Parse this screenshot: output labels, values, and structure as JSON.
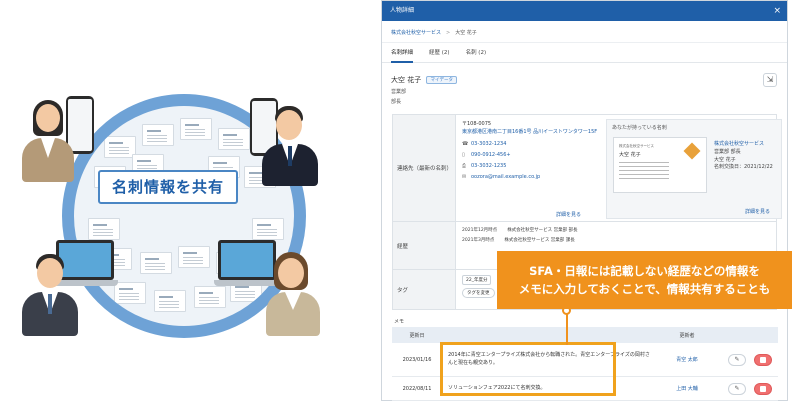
{
  "illustration": {
    "share_label": "名刺情報を共有"
  },
  "window": {
    "title": "人物詳細",
    "close_glyph": "×",
    "breadcrumb": {
      "company": "株式会社秋空サービス",
      "separator": ">",
      "person": "大空 花子"
    },
    "tabs": [
      {
        "label": "名刺詳細",
        "active": true
      },
      {
        "label": "経歴 (2)",
        "active": false
      },
      {
        "label": "名刺 (2)",
        "active": false
      }
    ],
    "person": {
      "name": "大空 花子",
      "badge": "マイデータ",
      "department": "営業部",
      "title": "部長",
      "export_icon": "export-icon"
    },
    "contact": {
      "label": "連絡先（最新の名刺）",
      "zip": "〒108-0075",
      "address": "東京都港区港南二丁目16番1号 品川イーストワンタワー15F",
      "phone": "03-3032-1234",
      "mobile": "090-0912-456+",
      "fax": "03-3032-1235",
      "email": "oozora@mail.example.co.jp",
      "more": "詳細を見る"
    },
    "card": {
      "title": "あなたが持っている名刺",
      "mini_org": "株式会社秋空サービス",
      "mini_name": "大空 花子",
      "company": "株式会社秋空サービス",
      "dept_title": "営業部 部長",
      "name": "大空 花子",
      "exchanged": "名刺交換日：2021/12/22",
      "more": "詳細を見る"
    },
    "career": {
      "label": "経歴",
      "entries": [
        {
          "date": "2021年12月時点",
          "text": "株式会社秋空サービス 営業部 部長"
        },
        {
          "date": "2021年3月時点",
          "text": "株式会社秋空サービス 営業部 課長"
        }
      ]
    },
    "tag": {
      "label": "タグ",
      "chip": "22_年度分",
      "add": "タグを変更"
    },
    "memo": {
      "title": "メモ",
      "headers": {
        "date": "更新日",
        "user": "更新者"
      },
      "rows": [
        {
          "date": "2023/01/16",
          "text": "2014年に青空エンタープライズ株式会社から転職された。青空エンタープライズの岡村さんと現在も親交あり。",
          "user": "青空 太郎"
        },
        {
          "date": "2022/08/11",
          "text": "ソリューションフェア2022にて名刺交換。",
          "user": "上田 大輔"
        }
      ]
    }
  },
  "callout": {
    "line1": "SFA・日報には記載しない経歴などの情報を",
    "line2": "メモに入力しておくことで、情報共有することも"
  },
  "colors": {
    "accent": "#1f5fa8",
    "callout": "#f0921d",
    "ring": "#6ea2d6"
  }
}
